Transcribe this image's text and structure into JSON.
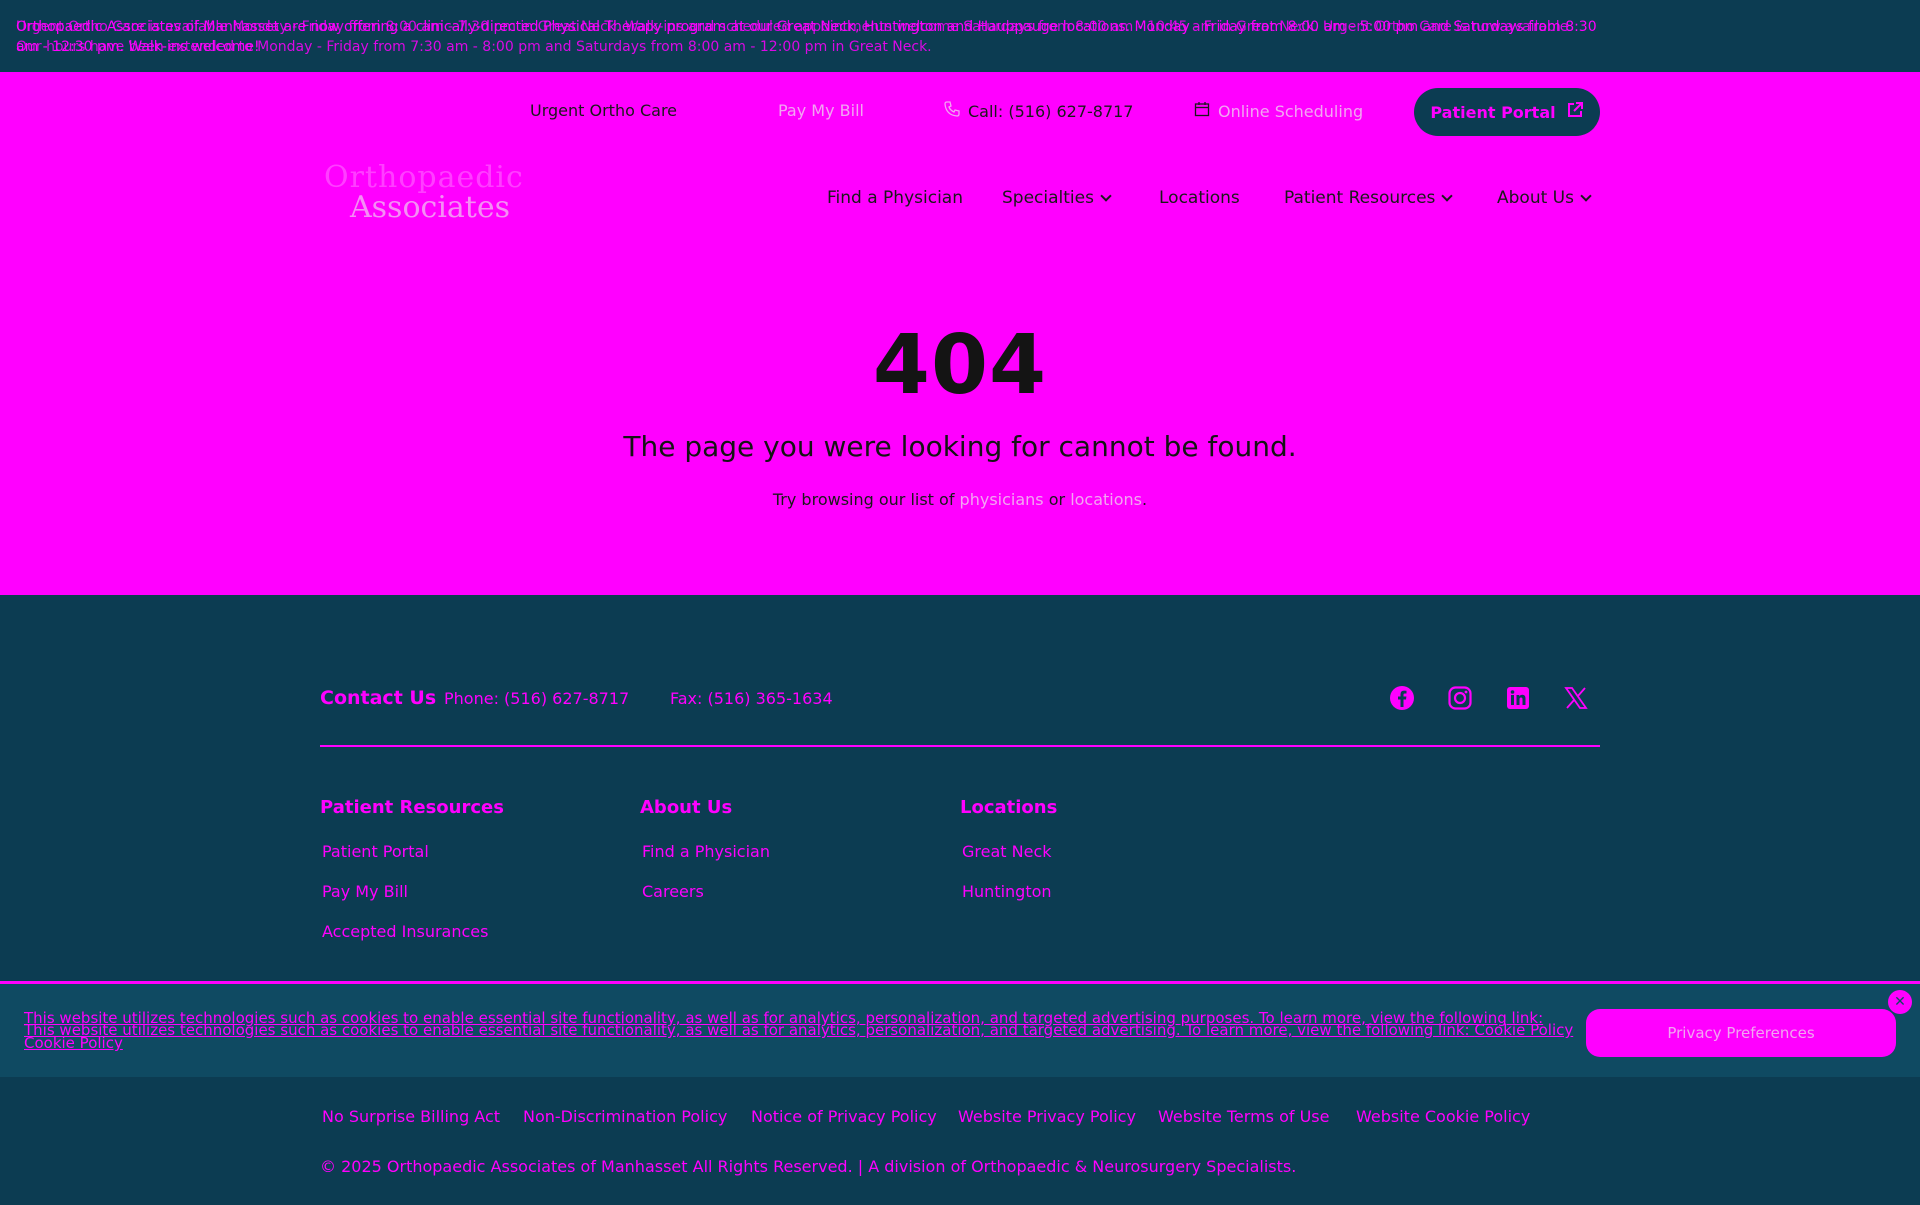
{
  "announcement": {
    "line1a": "Orthopaedic Associates of Manhasset are now offering a clinically-directed Physical Therapy program at our Great Neck, Huntington and Hauppauge locations. Monday - Friday from 8:00 am - 5:00 pm and Saturdays from 8:30",
    "line1b": "Urgent Ortho Care is available Monday - Friday from 8:00 am - 7:30 pm in Great Neck. Walk-ins and scheduled appointments welcome Saturdays from 8:00 am - 10:45 am in Great Neck. Urgent Ortho Care is now available",
    "line2a": "am - 12:30 pm. Walk-ins welcome!",
    "line2b": "Our hours have been extended to Monday - Friday from 7:30 am - 8:00 pm and Saturdays from 8:00 am - 12:00 pm in Great Neck."
  },
  "utility": {
    "urgent": "Urgent Ortho Care",
    "pay_bill": "Pay My Bill",
    "call": "Call: (516) 627-8717",
    "online_scheduling": "Online Scheduling",
    "portal": "Patient Portal"
  },
  "logo": {
    "line1": "Orthopaedic",
    "line2": "Associates"
  },
  "nav": {
    "find": "Find a Physician",
    "specialties": "Specialties",
    "locations": "Locations",
    "resources": "Patient Resources",
    "about": "About Us"
  },
  "error": {
    "code": "404",
    "message": "The page you were looking for cannot be found.",
    "help_prefix": "Try browsing our list of",
    "help_link1": "physicians",
    "help_or": "or",
    "help_link2": "locations",
    "help_end": "."
  },
  "footer": {
    "contact_title": "Contact Us",
    "phone": "Phone: (516) 627-8717",
    "fax": "Fax: (516) 365-1634",
    "col1_title": "Patient Resources",
    "col1_links": [
      "Patient Portal",
      "Pay My Bill",
      "Accepted Insurances"
    ],
    "col2_title": "About Us",
    "col2_links": [
      "Find a Physician",
      "Careers"
    ],
    "col3_title": "Locations",
    "col3_links": [
      "Great Neck",
      "Huntington"
    ]
  },
  "cookie": {
    "text1": "This website utilizes technologies such as cookies to enable essential site functionality, as well as for analytics, personalization, and targeted advertising purposes. To learn more, view the following link:",
    "text2": "This website utilizes technologies such as cookies to enable essential site functionality, as well as for analytics, personalization, and targeted advertising. To learn more, view the following link:",
    "policy_link": "Cookie Policy",
    "policy_link2": "Cookie Policy",
    "button": "Privacy Preferences"
  },
  "legal": {
    "links": [
      "No Surprise Billing Act",
      "Non-Discrimination Policy",
      "Notice of Privacy Policy",
      "Website Privacy Policy",
      "Website Terms of Use",
      "Website Cookie Policy"
    ],
    "copyright": "© 2025 Orthopaedic Associates of Manhasset All Rights Reserved. | A division of Orthopaedic & Neurosurgery Specialists."
  },
  "colors": {
    "background": "#ff00ff",
    "footer": "#0c3c52",
    "text": "#141414"
  }
}
